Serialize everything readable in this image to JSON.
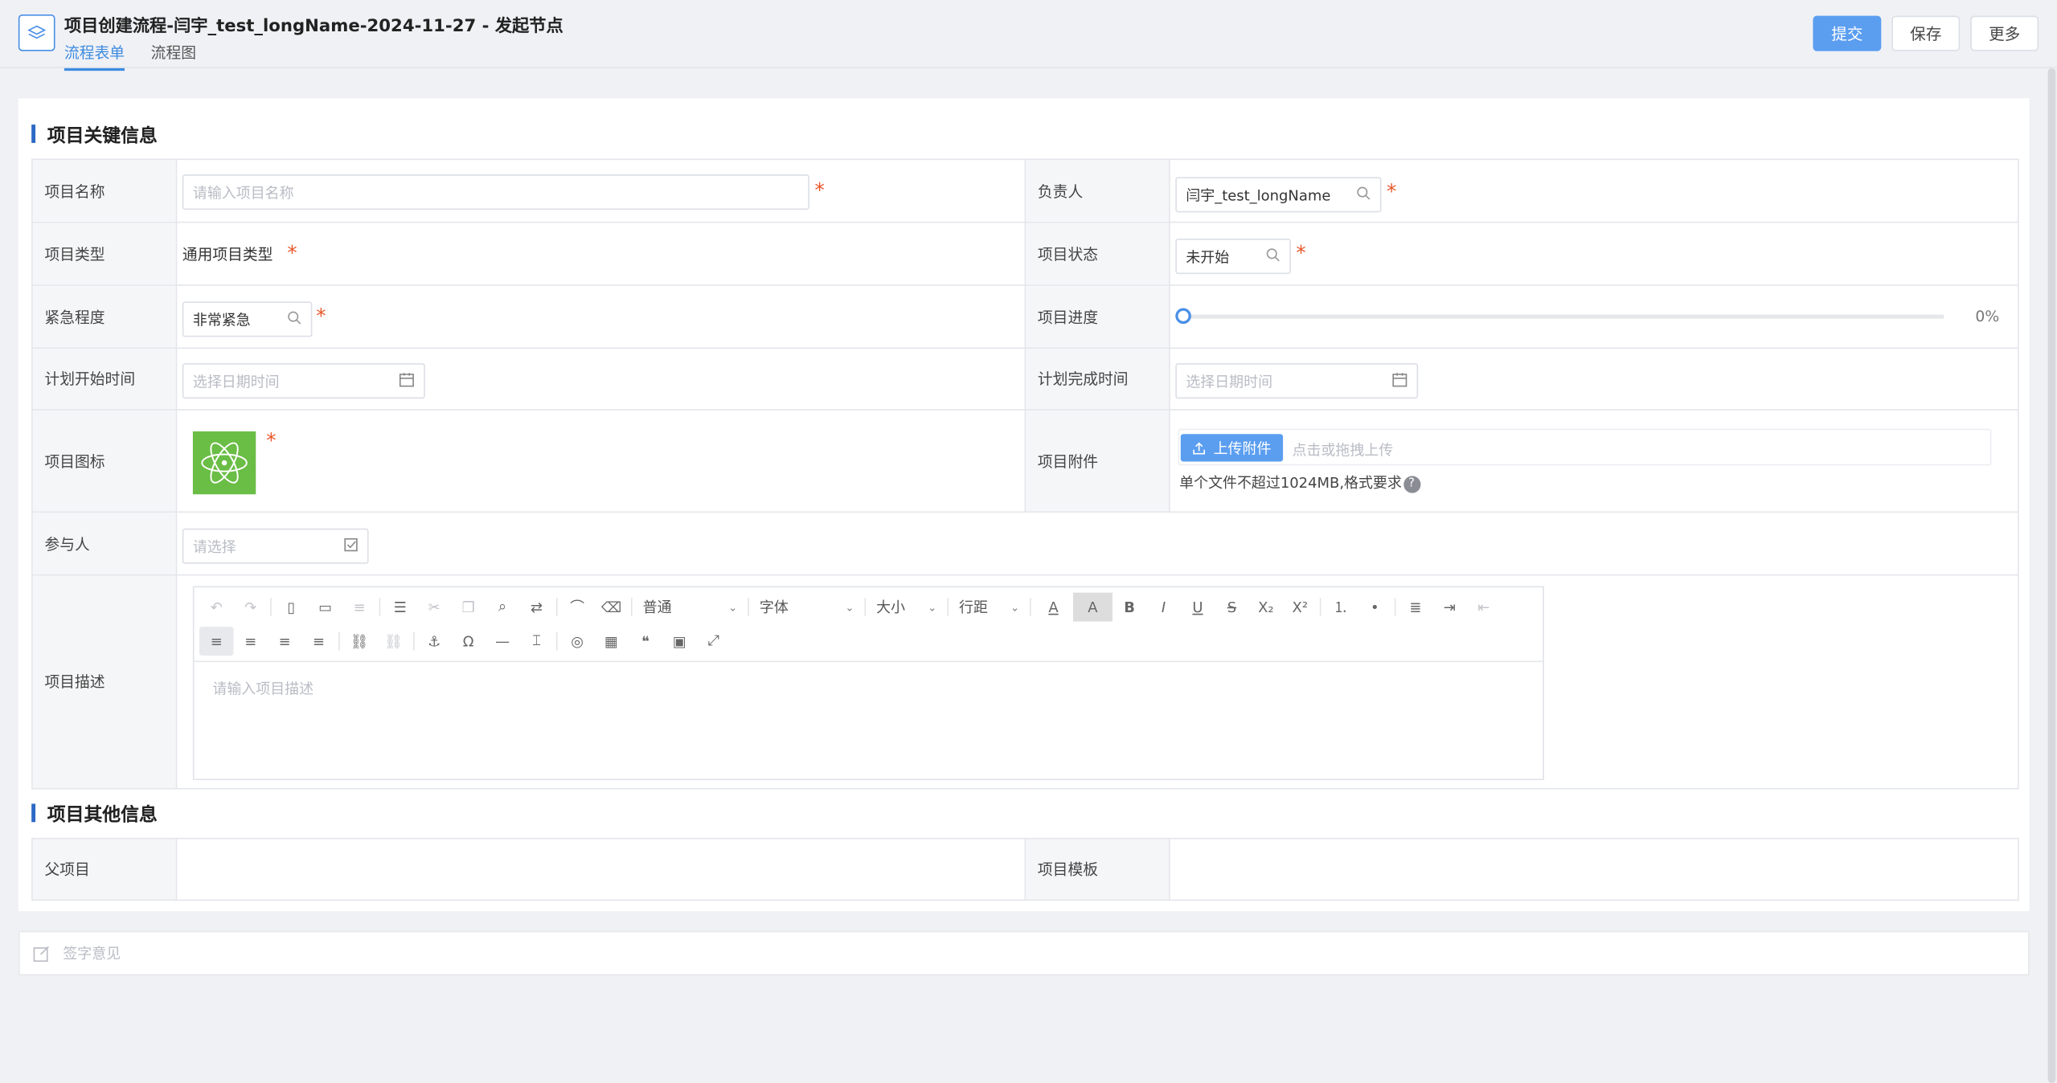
{
  "header": {
    "title": "项目创建流程-闫宇_test_longName-2024-11-27 - 发起节点",
    "tabs": [
      {
        "label": "流程表单",
        "active": true
      },
      {
        "label": "流程图",
        "active": false
      }
    ],
    "buttons": {
      "submit": "提交",
      "save": "保存",
      "more": "更多"
    }
  },
  "sections": {
    "key_info": "项目关键信息",
    "other_info": "项目其他信息"
  },
  "fields": {
    "name": {
      "label": "项目名称",
      "placeholder": "请输入项目名称",
      "required": "*"
    },
    "owner": {
      "label": "负责人",
      "value": "闫宇_test_longName",
      "required": "*"
    },
    "type": {
      "label": "项目类型",
      "value": "通用项目类型",
      "required": "*"
    },
    "status": {
      "label": "项目状态",
      "value": "未开始",
      "required": "*"
    },
    "urgency": {
      "label": "紧急程度",
      "value": "非常紧急",
      "required": "*"
    },
    "progress": {
      "label": "项目进度",
      "value": 0,
      "display": "0%"
    },
    "plan_start": {
      "label": "计划开始时间",
      "placeholder": "选择日期时间"
    },
    "plan_end": {
      "label": "计划完成时间",
      "placeholder": "选择日期时间"
    },
    "icon": {
      "label": "项目图标",
      "icon": "atom-icon",
      "color": "#6abd45",
      "required": "*"
    },
    "attachment": {
      "label": "项目附件",
      "upload_label": "上传附件",
      "drop_hint": "点击或拖拽上传",
      "limit_hint": "单个文件不超过1024MB,格式要求",
      "help": "?"
    },
    "participants": {
      "label": "参与人",
      "placeholder": "请选择"
    },
    "description": {
      "label": "项目描述",
      "placeholder": "请输入项目描述"
    },
    "parent": {
      "label": "父项目"
    },
    "template": {
      "label": "项目模板"
    }
  },
  "editor": {
    "paragraph": "普通",
    "font": "字体",
    "size": "大小",
    "line_height": "行距",
    "text_color": "A",
    "bg_color": "A",
    "bold": "B",
    "italic": "I",
    "underline": "U",
    "strike": "S",
    "subscript": "X₂",
    "superscript": "X²"
  },
  "sign": {
    "label": "签字意见"
  },
  "colors": {
    "primary": "#5b9ef0",
    "required": "#e8562a",
    "accent": "#2d68c4"
  }
}
